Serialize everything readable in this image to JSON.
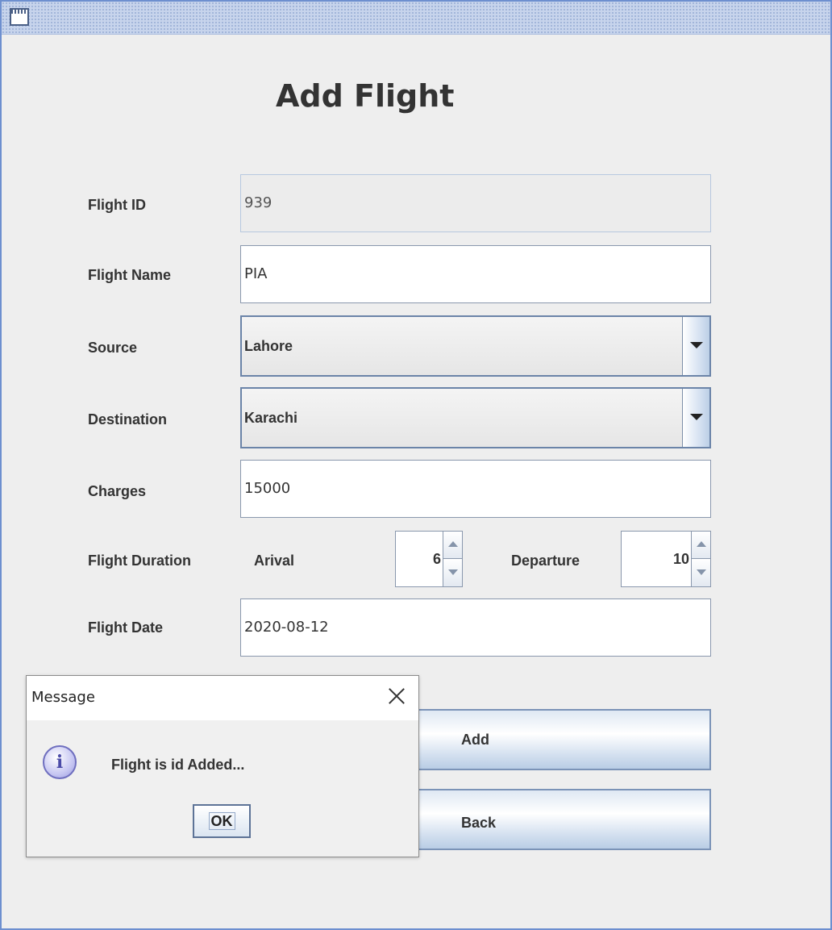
{
  "window": {
    "icon": "window-icon"
  },
  "form": {
    "heading": "Add Flight",
    "flight_id": {
      "label": "Flight ID",
      "value": "939"
    },
    "flight_name": {
      "label": "Flight Name",
      "value": "PIA"
    },
    "source": {
      "label": "Source",
      "selected": "Lahore"
    },
    "destination": {
      "label": "Destination",
      "selected": "Karachi"
    },
    "charges": {
      "label": "Charges",
      "value": "15000"
    },
    "duration": {
      "label": "Flight Duration",
      "arrival_label": "Arival",
      "arrival_value": "6",
      "departure_label": "Departure",
      "departure_value": "10"
    },
    "flight_date": {
      "label": "Flight Date",
      "value": "2020-08-12"
    },
    "add_label": "Add",
    "back_label": "Back"
  },
  "dialog": {
    "title": "Message",
    "message": "Flight is id Added...",
    "ok_label": "OK",
    "icon": "info-icon"
  },
  "colors": {
    "window_border": "#6d8fcf",
    "background": "#eeeeee",
    "button_border": "#7b93b7"
  }
}
